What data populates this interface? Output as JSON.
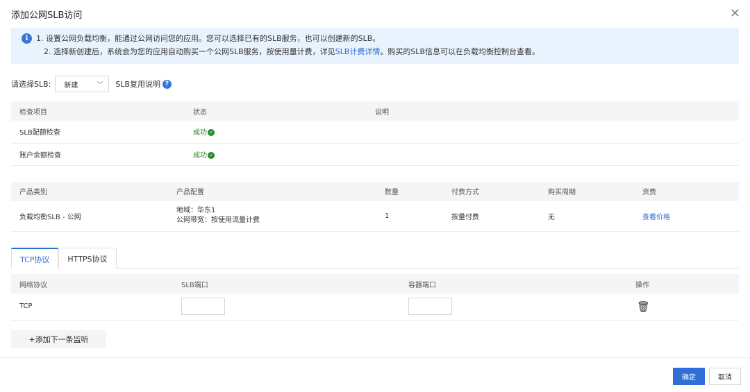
{
  "dialog": {
    "title": "添加公网SLB访问",
    "close_glyph": "✕"
  },
  "notice": {
    "line1": "1. 设置公网负载均衡，能通过公网访问您的应用。您可以选择已有的SLB服务，也可以创建新的SLB。",
    "line2_prefix": "2. 选择新创建后，系统会为您的应用自动购买一个公网SLB服务，按使用量计费，详见",
    "line2_link": "SLB计费详情",
    "line2_suffix": "。购买的SLB信息可以在负载均衡控制台查看。"
  },
  "slb_select": {
    "label": "请选择SLB:",
    "value": "新建",
    "reuse_text": "SLB复用说明",
    "help_glyph": "?"
  },
  "check_table": {
    "headers": [
      "检查项目",
      "状态",
      "说明"
    ],
    "rows": [
      {
        "item": "SLB配额检查",
        "status": "成功",
        "note": ""
      },
      {
        "item": "账户余额检查",
        "status": "成功",
        "note": ""
      }
    ]
  },
  "product_table": {
    "headers": [
      "产品类别",
      "产品配置",
      "数量",
      "付费方式",
      "购买周期",
      "资费"
    ],
    "row": {
      "category": "负载均衡SLB - 公网",
      "config_line1": "地域：华东1",
      "config_line2": "公网带宽：按使用流量计费",
      "quantity": "1",
      "payment": "按量付费",
      "period": "无",
      "price_link": "查看价格"
    }
  },
  "tabs": [
    {
      "label": "TCP协议",
      "active": true
    },
    {
      "label": "HTTPS协议",
      "active": false
    }
  ],
  "listener_table": {
    "headers": [
      "网络协议",
      "SLB端口",
      "容器端口",
      "操作"
    ],
    "rows": [
      {
        "protocol": "TCP",
        "slb_port": "",
        "container_port": ""
      }
    ]
  },
  "add_listener_label": "+添加下一条监听",
  "footer": {
    "ok_label": "确定",
    "cancel_label": "取消"
  },
  "colors": {
    "primary": "#2f6fd6",
    "success": "#2b8a2b",
    "notice_bg": "#e9f3fd"
  }
}
